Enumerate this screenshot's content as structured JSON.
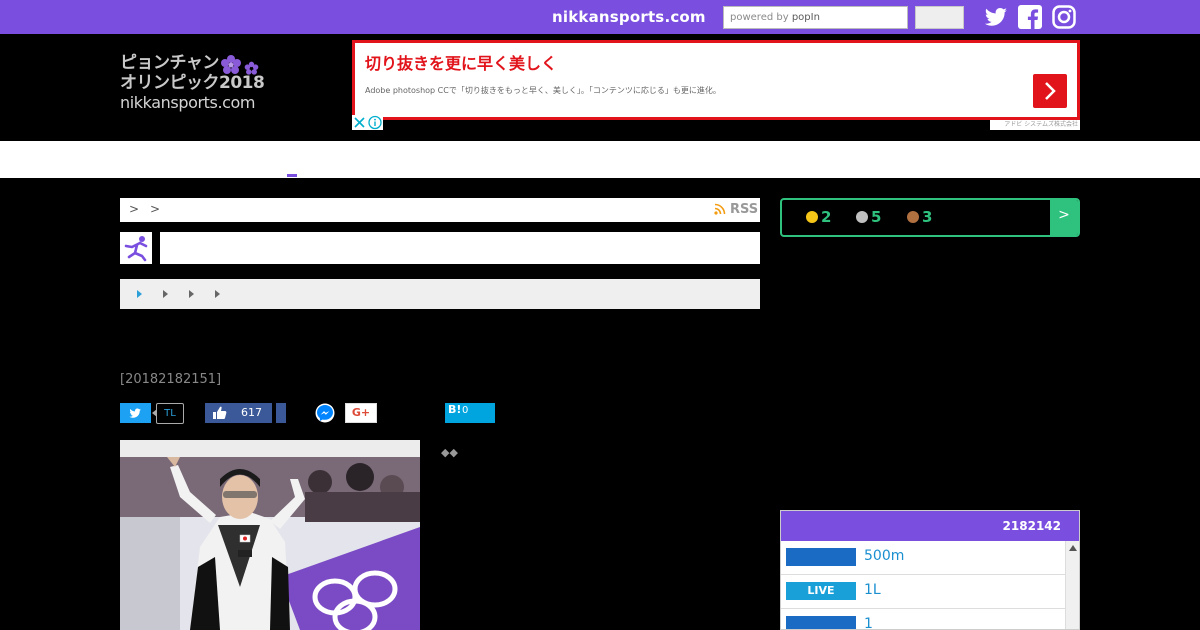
{
  "topbar": {
    "brand": "nikkansports.com",
    "search_powered_by": "powered by",
    "search_provider": "popIn",
    "social_icons": [
      "twitter-icon",
      "facebook-icon",
      "instagram-icon"
    ]
  },
  "logo": {
    "line1": "ピョンチャン",
    "line2": "オリンピック2018",
    "line3": "nikkansports.com"
  },
  "ad": {
    "title": "切り抜きを更に早く美しく",
    "body": "Adobe photoshop CCで「切り抜きをもっと早く、美しく」。「コンテンツに応じる」も更に進化。",
    "footer": "アドビ システムズ株式会社"
  },
  "breadcrumb": {
    "sep1": ">",
    "sep2": ">",
    "rss": "RSS"
  },
  "article": {
    "date": "[20182182151]"
  },
  "share": {
    "tl_label": "TL",
    "fb_count": "617",
    "gplus_label": "G+",
    "hatena_label": "B!",
    "hatena_count": "0"
  },
  "diamonds": "◆◆",
  "medals": {
    "gold": "2",
    "silver": "5",
    "bronze": "3",
    "arrow": ">",
    "colors": {
      "gold": "#f5c518",
      "silver": "#c0c0c0",
      "bronze": "#b07040",
      "accent": "#2ec27e"
    }
  },
  "schedule": {
    "header": "2182142",
    "rows": [
      {
        "tag": "",
        "label": "500m",
        "live": false
      },
      {
        "tag": "LIVE",
        "label": "1L",
        "live": true
      },
      {
        "tag": "",
        "label": "1",
        "live": false
      }
    ]
  },
  "colors": {
    "purple": "#7a4fe0",
    "twitter": "#1da1f2",
    "facebook": "#3b5998",
    "hatena": "#00a4de",
    "ad_red": "#e2141b"
  }
}
